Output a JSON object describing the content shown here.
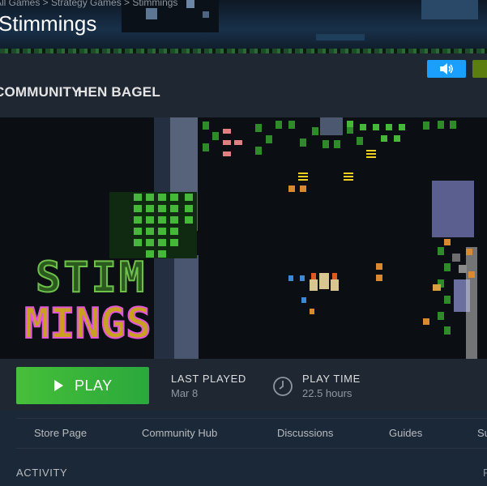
{
  "header": {
    "breadcrumb": "All Games > Strategy Games > Stimmings",
    "title": "Stimmings"
  },
  "nav": {
    "items": [
      "COMMUNITY",
      "HEN BAGEL"
    ]
  },
  "hero": {
    "logo_line1": "STIM",
    "logo_line2": "MINGS"
  },
  "play": {
    "label": "PLAY",
    "last_played_label": "LAST PLAYED",
    "last_played_value": "Mar 8",
    "play_time_label": "PLAY TIME",
    "play_time_value": "22.5 hours"
  },
  "subnav": {
    "items": [
      "Store Page",
      "Community Hub",
      "Discussions",
      "Guides",
      "Su"
    ]
  },
  "activity": {
    "label": "ACTIVITY",
    "right": "F"
  },
  "colors": {
    "accent": "#1a9fff",
    "play": "#47bf3a",
    "background": "#1b2838"
  }
}
